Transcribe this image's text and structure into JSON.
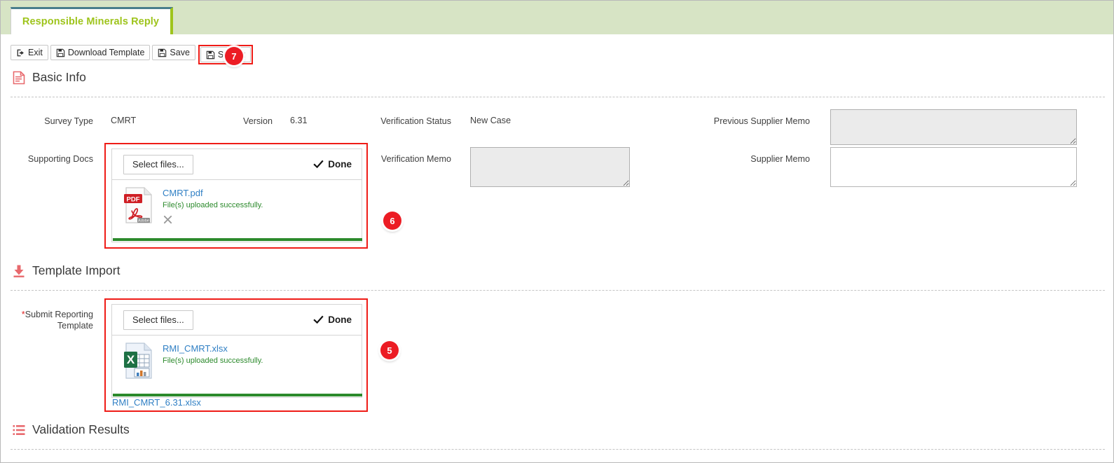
{
  "tab": {
    "label": "Responsible Minerals Reply"
  },
  "toolbar": {
    "exit": "Exit",
    "download_template": "Download Template",
    "save": "Save",
    "submit": "Submit"
  },
  "badges": {
    "seven": "7",
    "six": "6",
    "five": "5"
  },
  "sections": {
    "basic_info": "Basic Info",
    "template_import": "Template Import",
    "validation_results": "Validation Results"
  },
  "basic_info": {
    "survey_type_label": "Survey Type",
    "survey_type_value": "CMRT",
    "version_label": "Version",
    "version_value": "6.31",
    "verification_status_label": "Verification Status",
    "verification_status_value": "New Case",
    "previous_supplier_memo_label": "Previous Supplier Memo",
    "previous_supplier_memo_value": "",
    "supporting_docs_label": "Supporting Docs",
    "verification_memo_label": "Verification Memo",
    "verification_memo_value": "",
    "supplier_memo_label": "Supplier Memo",
    "supplier_memo_value": ""
  },
  "template_import": {
    "submit_reporting_template_label_required": "*",
    "submit_reporting_template_label": "Submit Reporting Template",
    "template_file_link": "RMI_CMRT_6.31.xlsx"
  },
  "uploader_docs": {
    "select_files": "Select files...",
    "done": "Done",
    "file_name": "CMRT.pdf",
    "file_status": "File(s) uploaded successfully.",
    "file_type": "pdf"
  },
  "uploader_template": {
    "select_files": "Select files...",
    "done": "Done",
    "file_name": "RMI_CMRT.xlsx",
    "file_status": "File(s) uploaded successfully.",
    "file_type": "xlsx"
  },
  "colors": {
    "accent_green": "#9ec41c",
    "header_band": "#d7e4c5",
    "tab_top": "#4a7f8c",
    "annotation_red": "#ec1c24",
    "link_blue": "#2f7fc4",
    "success_green": "#2c8a2c",
    "section_icon_red": "#e8696d"
  }
}
